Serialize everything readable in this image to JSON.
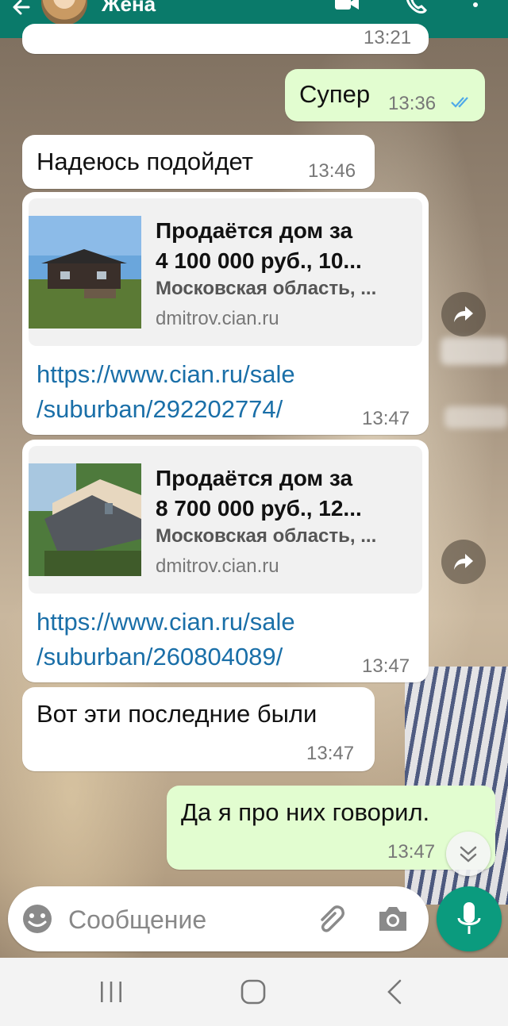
{
  "header": {
    "contact_name": "Жена",
    "icons": [
      "back-arrow-icon",
      "video-call-icon",
      "voice-call-icon",
      "more-options-icon"
    ]
  },
  "messages": [
    {
      "id": "top-partial",
      "direction": "in",
      "time": "13:21"
    },
    {
      "id": "m1",
      "direction": "out",
      "text": "Супер",
      "time": "13:36",
      "status": "read"
    },
    {
      "id": "m2",
      "direction": "in",
      "text": "Надеюсь подойдет",
      "time": "13:46"
    },
    {
      "id": "m3",
      "direction": "in",
      "time": "13:47",
      "preview": {
        "title_line1": "Продаётся дом за",
        "title_line2": "4 100 000 руб., 10...",
        "description": "Московская область, ...",
        "domain": "dmitrov.cian.ru"
      },
      "link_line1": "https://www.cian.ru/sale",
      "link_line2": "/suburban/292202774/"
    },
    {
      "id": "m4",
      "direction": "in",
      "time": "13:47",
      "preview": {
        "title_line1": "Продаётся дом за",
        "title_line2": "8 700 000 руб., 12...",
        "description": "Московская область, ...",
        "domain": "dmitrov.cian.ru"
      },
      "link_line1": "https://www.cian.ru/sale",
      "link_line2": "/suburban/260804089/"
    },
    {
      "id": "m5",
      "direction": "in",
      "text": "Вот эти последние были",
      "time": "13:47"
    },
    {
      "id": "m6",
      "direction": "out",
      "text": "Да я про них говорил.",
      "time": "13:47"
    }
  ],
  "composer": {
    "placeholder": "Сообщение",
    "icons": [
      "emoji-icon",
      "attach-icon",
      "camera-icon",
      "mic-icon"
    ]
  },
  "colors": {
    "app_bar": "#0a7a6a",
    "outgoing_bubble": "#e2fdd0",
    "incoming_bubble": "#ffffff",
    "link": "#1a6fa8",
    "read_ticks": "#4fa9e8",
    "mic_button": "#0b9b7e"
  }
}
